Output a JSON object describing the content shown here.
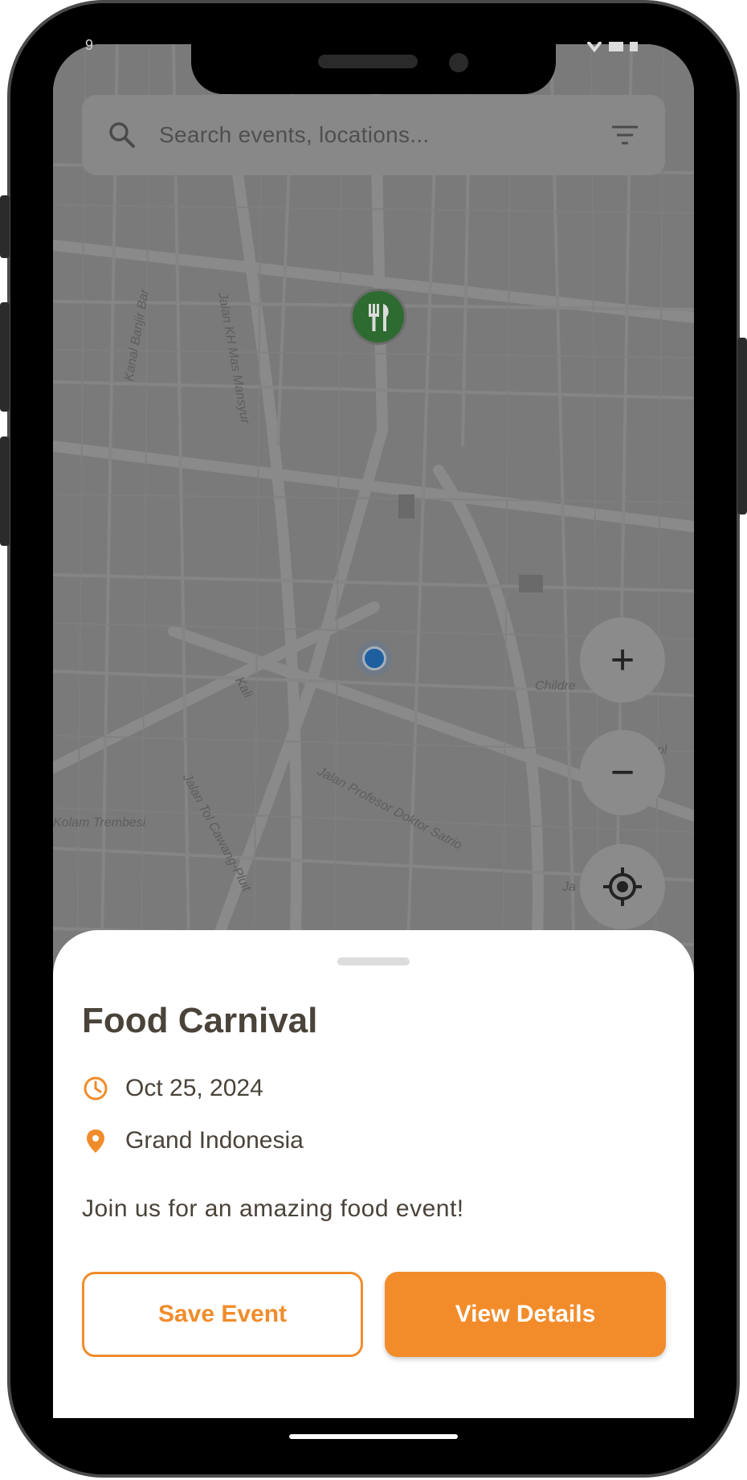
{
  "status_bar": {
    "time": "9",
    "right_icons": "signal-battery"
  },
  "search": {
    "placeholder": "Search events, locations..."
  },
  "map": {
    "labels": [
      "Kanal Banjir Bar",
      "Jalan KH Mas Mansyur",
      "Kali",
      "Jalan Tol Cawang-Pluit",
      "Jalan Profesor Doktor Satrio",
      "Kolam Trembesi",
      "Childre",
      "Ja",
      "ol"
    ],
    "markers": [
      {
        "type": "food",
        "icon": "fork-knife-icon"
      }
    ],
    "controls": {
      "zoom_in": "+",
      "zoom_out": "−",
      "locate_icon": "crosshair-icon"
    }
  },
  "event": {
    "title": "Food Carnival",
    "date": "Oct 25, 2024",
    "location": "Grand Indonesia",
    "description": "Join us for an amazing food event!",
    "save_label": "Save Event",
    "details_label": "View Details"
  },
  "colors": {
    "accent": "#f28c2b",
    "text": "#4a4339",
    "marker": "#2e6b31",
    "user": "#1e5fa0"
  }
}
